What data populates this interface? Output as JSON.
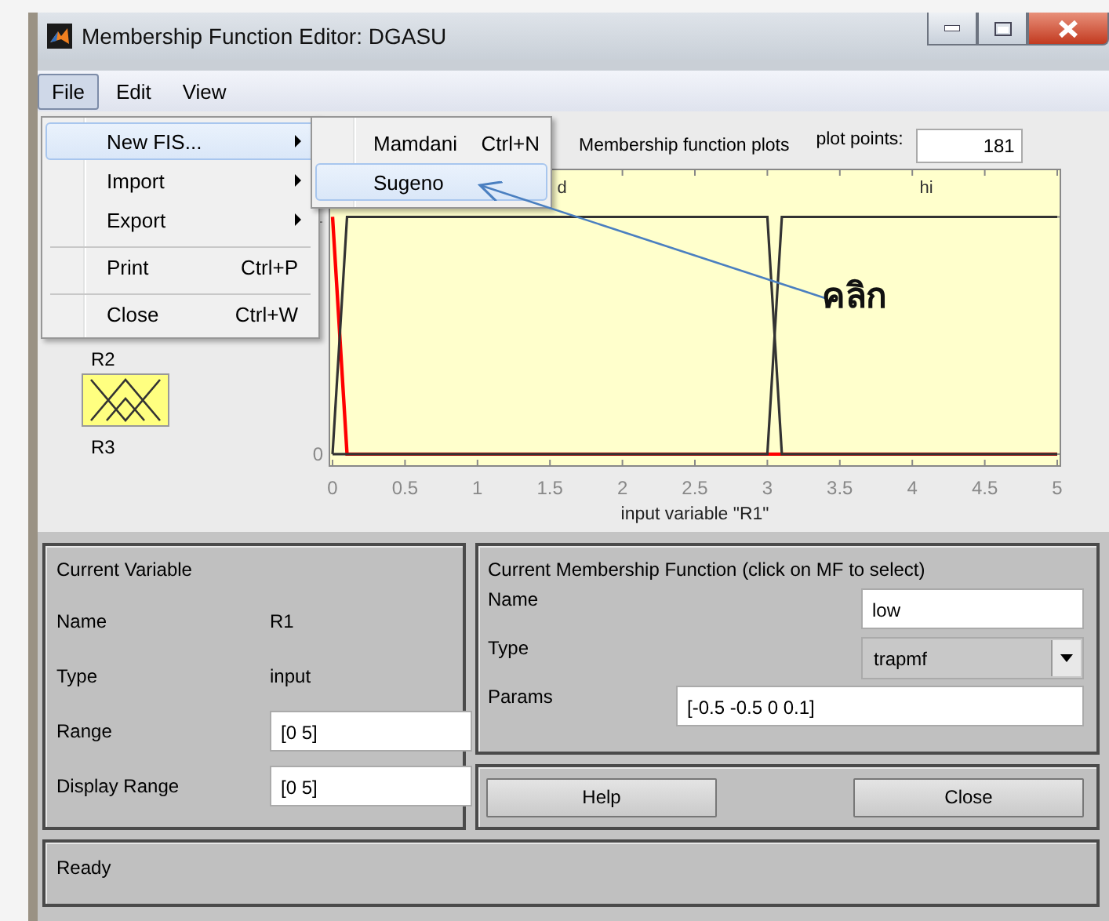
{
  "window": {
    "title": "Membership Function Editor: DGASU"
  },
  "menu_bar": [
    {
      "label": "File",
      "selected": true
    },
    {
      "label": "Edit",
      "selected": false
    },
    {
      "label": "View",
      "selected": false
    }
  ],
  "file_menu": [
    {
      "label": "New FIS...",
      "submenu": true,
      "selected": true,
      "separator_before": false
    },
    {
      "label": "Import",
      "submenu": true,
      "selected": false,
      "separator_before": false
    },
    {
      "label": "Export",
      "submenu": true,
      "selected": false,
      "separator_before": false
    },
    {
      "label": "Print",
      "shortcut": "Ctrl+P",
      "submenu": false,
      "selected": false,
      "separator_before": true
    },
    {
      "label": "Close",
      "shortcut": "Ctrl+W",
      "submenu": false,
      "selected": false,
      "separator_before": true
    }
  ],
  "new_fis_submenu": [
    {
      "label": "Mamdani",
      "shortcut": "Ctrl+N",
      "selected": false
    },
    {
      "label": "Sugeno",
      "selected": true
    }
  ],
  "annotation": {
    "text": "คลิก"
  },
  "fis_variables": [
    {
      "label": "R2"
    },
    {
      "label": "R3"
    }
  ],
  "plot_header": {
    "title": "Membership function plots",
    "points_label": "plot points:",
    "points_value": "181"
  },
  "chart_data": {
    "type": "line",
    "xlabel": "input variable \"R1\"",
    "x": [
      0,
      0.1,
      3.0,
      3.1,
      5
    ],
    "series": [
      {
        "color": "#ff0000",
        "values": [
          1,
          0,
          0,
          0,
          0
        ]
      },
      {
        "color": "#333333",
        "values": [
          0,
          1,
          1,
          0,
          0
        ]
      },
      {
        "color": "#333333",
        "values": [
          0,
          0,
          0,
          1,
          1
        ]
      }
    ],
    "xlim": [
      0,
      5
    ],
    "ylim": [
      -0.05,
      1.2
    ],
    "xticks": [
      0,
      0.5,
      1,
      1.5,
      2,
      2.5,
      3,
      3.5,
      4,
      4.5,
      5
    ],
    "yticks": [
      0,
      1
    ],
    "annotations": [
      "d",
      "hi"
    ]
  },
  "current_variable": {
    "title": "Current Variable",
    "rows": [
      {
        "kind": "text",
        "label": "Name",
        "value": "R1"
      },
      {
        "kind": "text",
        "label": "Type",
        "value": "input"
      },
      {
        "kind": "field",
        "label": "Range",
        "value": "[0 5]"
      },
      {
        "kind": "field",
        "label": "Display Range",
        "value": "[0 5]"
      }
    ]
  },
  "current_mf": {
    "title": "Current Membership Function (click on MF to select)",
    "rows": [
      {
        "kind": "field",
        "label": "Name",
        "value": "low"
      },
      {
        "kind": "dropdown",
        "label": "Type",
        "value": "trapmf"
      },
      {
        "kind": "wide_field",
        "label": "Params",
        "value": "[-0.5 -0.5 0 0.1]"
      }
    ]
  },
  "buttons": [
    "Help",
    "Close"
  ],
  "status_bar": "Ready"
}
